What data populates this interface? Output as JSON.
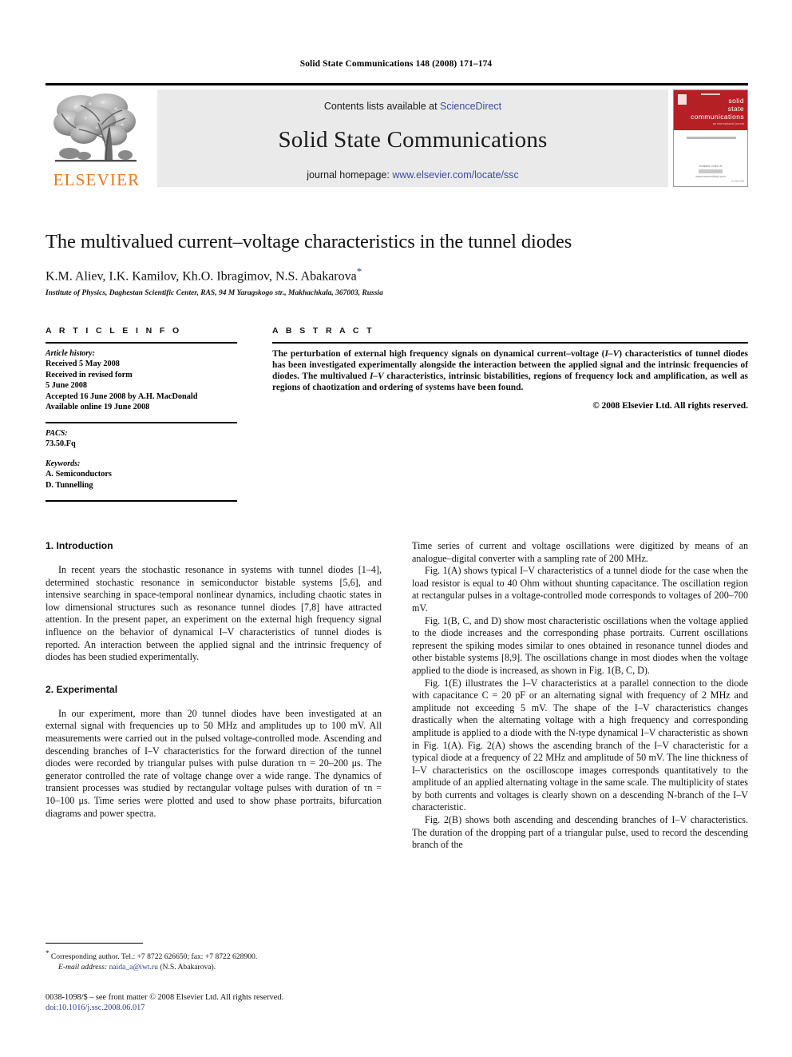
{
  "running_head": "Solid State Communications 148 (2008) 171–174",
  "masthead": {
    "contents_prefix": "Contents lists available at ",
    "contents_link": "ScienceDirect",
    "journal_title": "Solid State Communications",
    "homepage_prefix": "journal homepage: ",
    "homepage_link": "www.elsevier.com/locate/ssc",
    "publisher_wordmark": "ELSEVIER",
    "cover": {
      "line1": "solid",
      "line2": "state",
      "line3": "communications",
      "sub": "an international journal",
      "band": "a journal for rapid communication",
      "bottom1": "Available online at",
      "bottom2": "ScienceDirect",
      "bottom3": "www.sciencedirect.com",
      "corner": "ELSEVIER",
      "red": "#b52025"
    },
    "accent_link_color": "#3b4ba0",
    "elsevier_orange": "#E87722"
  },
  "article": {
    "title": "The multivalued current–voltage characteristics in the tunnel diodes",
    "authors": "K.M. Aliev, I.K. Kamilov, Kh.O. Ibragimov, N.S. Abakarova",
    "corresponding_marker": "*",
    "affiliation": "Institute of Physics, Daghestan Scientific Center, RAS, 94 M Yaragskogo str., Makhachkala, 367003, Russia"
  },
  "info": {
    "heading": "A R T I C L E   I N F O",
    "history_label": "Article history:",
    "history": [
      "Received 5 May 2008",
      "Received in revised form",
      "5 June 2008",
      "Accepted 16 June 2008 by A.H. MacDonald",
      "Available online 19 June 2008"
    ],
    "pacs_label": "PACS:",
    "pacs": "73.50.Fq",
    "keywords_label": "Keywords:",
    "keywords": [
      "A. Semiconductors",
      "D. Tunnelling"
    ]
  },
  "abstract": {
    "heading": "A B S T R A C T",
    "text_parts": [
      "The perturbation of external high frequency signals on dynamical current–voltage (",
      "I–V",
      ") characteristics of tunnel diodes has been investigated experimentally alongside the interaction between the applied signal and the intrinsic frequencies of diodes. The multivalued ",
      "I–V",
      " characteristics, intrinsic bistabilities, regions of frequency lock and amplification, as well as regions of chaotization and ordering of systems have been found."
    ],
    "copyright": "© 2008 Elsevier Ltd. All rights reserved."
  },
  "sections": {
    "intro_heading": "1.  Introduction",
    "experimental_heading": "2.  Experimental"
  },
  "paragraphs": {
    "intro": "In recent years the stochastic resonance in systems with tunnel diodes [1–4], determined stochastic resonance in semiconductor bistable systems [5,6], and intensive searching in space-temporal nonlinear dynamics, including chaotic states in low dimensional structures such as resonance tunnel diodes [7,8] have attracted attention. In the present paper, an experiment on the external high frequency signal influence on the behavior of dynamical I–V characteristics of tunnel diodes is reported. An interaction between the applied signal and the intrinsic frequency of diodes has been studied experimentally.",
    "experimental": "In our experiment, more than 20 tunnel diodes have been investigated at an external signal with frequencies up to 50 MHz and amplitudes up to 100 mV. All measurements were carried out in the pulsed voltage-controlled mode. Ascending and descending branches of I–V characteristics for the forward direction of the tunnel diodes were recorded by triangular pulses with pulse duration τn = 20–200 μs. The generator controlled the rate of voltage change over a wide range. The dynamics of transient processes was studied by rectangular voltage pulses with duration of τn = 10–100 μs. Time series were plotted and used to show phase portraits, bifurcation diagrams and power spectra.",
    "right_p1": "Time series of current and voltage oscillations were digitized by means of an analogue–digital converter with a sampling rate of 200 MHz.",
    "right_p2": "Fig. 1(A) shows typical I–V characteristics of a tunnel diode for the case when the load resistor is equal to 40 Ohm without shunting capacitance. The oscillation region at rectangular pulses in a voltage-controlled mode corresponds to voltages of 200–700 mV.",
    "right_p3": "Fig. 1(B, C, and D) show most characteristic oscillations when the voltage applied to the diode increases and the corresponding phase portraits. Current oscillations represent the spiking modes similar to ones obtained in resonance tunnel diodes and other bistable systems [8,9]. The oscillations change in most diodes when the voltage applied to the diode is increased, as shown in Fig. 1(B, C, D).",
    "right_p4": "Fig. 1(E) illustrates the I–V characteristics at a parallel connection to the diode with capacitance C = 20 pF or an alternating signal with frequency of 2 MHz and amplitude not exceeding 5 mV. The shape of the I–V characteristics changes drastically when the alternating voltage with a high frequency and corresponding amplitude is applied to a diode with the N-type dynamical I–V characteristic as shown in Fig. 1(A). Fig. 2(A) shows the ascending branch of the I–V characteristic for a typical diode at a frequency of 22 MHz and amplitude of 50 mV. The line thickness of I–V characteristics on the oscilloscope images corresponds quantitatively to the amplitude of an applied alternating voltage in the same scale. The multiplicity of states by both currents and voltages is clearly shown on a descending N-branch of the I–V characteristic.",
    "right_p5": "Fig. 2(B) shows both ascending and descending branches of I–V characteristics. The duration of the dropping part of a triangular pulse, used to record the descending branch of the"
  },
  "footnote": {
    "star": "*",
    "corresponding": "Corresponding author. Tel.: +7 8722 626650; fax: +7 8722 628900.",
    "email_label": "E-mail address:",
    "email": "naida_a@iwt.ru",
    "email_owner": "(N.S. Abakarova)."
  },
  "footer": {
    "issn_line": "0038-1098/$ – see front matter © 2008 Elsevier Ltd. All rights reserved.",
    "doi_label": "doi:",
    "doi": "10.1016/j.ssc.2008.06.017"
  }
}
